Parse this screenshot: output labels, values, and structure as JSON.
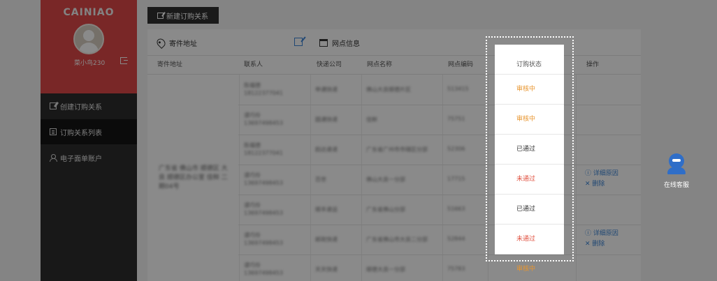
{
  "sidebar": {
    "brand": "CAINIAO",
    "username": "菜小鸟230",
    "items": [
      {
        "label": "创建订购关系",
        "active": false
      },
      {
        "label": "订购关系列表",
        "active": true
      },
      {
        "label": "电子面单账户",
        "active": false
      }
    ]
  },
  "toolbar": {
    "create_label": "新建订购关系"
  },
  "info_bar": {
    "sender_address_label": "寄件地址",
    "branch_info_label": "网点信息"
  },
  "table": {
    "headers": [
      "寄件地址",
      "联系人",
      "快递公司",
      "网点名称",
      "网点编码",
      "订购状态",
      "操作"
    ],
    "address": "广东省 佛山市 顺德区 大良 顺德区办公室 佳鲜 二期04号",
    "rows": [
      {
        "contact": "陈福德",
        "phone": "18122377041",
        "company": "申通快递",
        "branch": "佛山大良顺德片区",
        "code": "513415",
        "status": "审核中"
      },
      {
        "contact": "谭巧伶",
        "phone": "13697498453",
        "company": "圆通快递",
        "branch": "佳鲜",
        "code": "75751",
        "status": "审核中"
      },
      {
        "contact": "陈福德",
        "phone": "18122377041",
        "company": "韵达速递",
        "branch": "广东省广州市市辖区分部",
        "code": "52306",
        "status": "已通过"
      },
      {
        "contact": "谭巧伶",
        "phone": "13697498453",
        "company": "百世",
        "branch": "佛山大良一分部",
        "code": "17715",
        "status": "未通过",
        "actions": [
          "详细原因",
          "删除"
        ]
      },
      {
        "contact": "谭巧伶",
        "phone": "13697498453",
        "company": "顺丰速运",
        "branch": "广东省佛山分部",
        "code": "51663",
        "status": "已通过"
      },
      {
        "contact": "谭巧伶",
        "phone": "13697498453",
        "company": "邮政快递",
        "branch": "广东省佛山市大良二分部",
        "code": "52844",
        "status": "未通过",
        "actions": [
          "详细原因",
          "删除"
        ]
      },
      {
        "contact": "谭巧伶",
        "phone": "13697498453",
        "company": "天天快递",
        "branch": "顺德大良一分部",
        "code": "75783",
        "status": "审核中"
      }
    ]
  },
  "colors": {
    "pending": "#e8952e",
    "approved": "#333333",
    "rejected": "#e0503f",
    "accent": "#3d86d6",
    "brand_red": "#e04848"
  },
  "customer_service": {
    "label": "在线客服"
  }
}
